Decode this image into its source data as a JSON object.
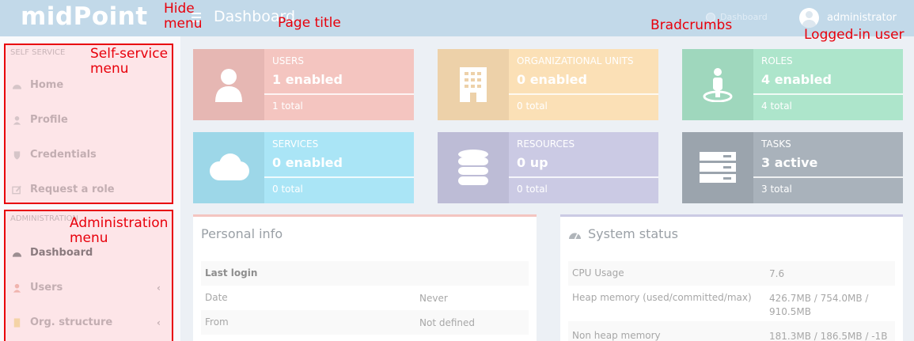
{
  "header": {
    "logo": "midPoint",
    "page_title": "Dashboard",
    "breadcrumb": "Dashboard",
    "user": "administrator"
  },
  "annotations": {
    "hide_menu": "Hide\nmenu",
    "page_title": "Page title",
    "breadcrumbs": "Bradcrumbs",
    "logged_in": "Logged-in user",
    "self_service": "Self-service\nmenu",
    "administration": "Administration\nmenu"
  },
  "sidebar": {
    "self_service_header": "SELF SERVICE",
    "self_service_items": [
      {
        "label": "Home",
        "icon": "dashboard-icon"
      },
      {
        "label": "Profile",
        "icon": "user-icon"
      },
      {
        "label": "Credentials",
        "icon": "shield-icon"
      },
      {
        "label": "Request a role",
        "icon": "edit-icon"
      }
    ],
    "admin_header": "ADMINISTRATION",
    "admin_items": [
      {
        "label": "Dashboard",
        "icon": "dashboard-icon"
      },
      {
        "label": "Users",
        "icon": "user-icon"
      },
      {
        "label": "Org. structure",
        "icon": "building-icon"
      }
    ]
  },
  "info_boxes": [
    {
      "label": "USERS",
      "value": "1 enabled",
      "total": "1 total",
      "color": "#f4c5c0",
      "icon_color": "#e6b7b3",
      "icon": "user-icon"
    },
    {
      "label": "ORGANIZATIONAL UNITS",
      "value": "0 enabled",
      "total": "0 total",
      "color": "#fbe0b6",
      "icon_color": "#edd1a9",
      "icon": "building-icon"
    },
    {
      "label": "ROLES",
      "value": "4 enabled",
      "total": "4 total",
      "color": "#ade5cb",
      "icon_color": "#9fd7bd",
      "icon": "role-icon"
    },
    {
      "label": "SERVICES",
      "value": "0 enabled",
      "total": "0 total",
      "color": "#aae5f6",
      "icon_color": "#9dd7e8",
      "icon": "cloud-icon"
    },
    {
      "label": "RESOURCES",
      "value": "0 up",
      "total": "0 total",
      "color": "#cbcae4",
      "icon_color": "#bdbcd6",
      "icon": "database-icon"
    },
    {
      "label": "TASKS",
      "value": "3 active",
      "total": "3 total",
      "color": "#a9b2bb",
      "icon_color": "#9ba4ad",
      "icon": "tasks-icon"
    }
  ],
  "personal_info": {
    "title": "Personal info",
    "section": "Last login",
    "rows": [
      {
        "key": "Date",
        "value": "Never"
      },
      {
        "key": "From",
        "value": "Not defined"
      }
    ]
  },
  "system_status": {
    "title": "System status",
    "rows": [
      {
        "key": "CPU Usage",
        "value": "7.6"
      },
      {
        "key": "Heap memory (used/committed/max)",
        "value": "426.7MB / 754.0MB /\n910.5MB"
      },
      {
        "key": "Non heap memory",
        "value": "181.3MB / 186.5MB / -1B"
      }
    ]
  },
  "colors": {
    "header": "#c2d9e9",
    "annotation": "#e8000b",
    "personal_border": "#f4c5c0",
    "system_border": "#cbcae4"
  }
}
